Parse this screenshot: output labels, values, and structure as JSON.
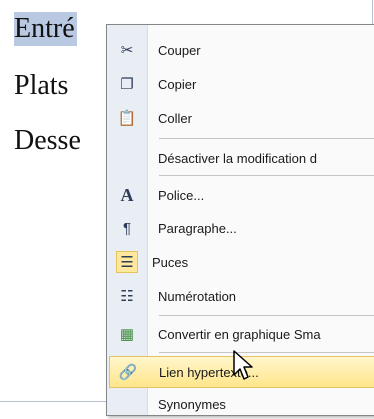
{
  "document": {
    "lines": [
      "Entré",
      "Plats",
      "Desse"
    ]
  },
  "context_menu": {
    "items": [
      {
        "label": "Couper",
        "icon": "scissors-icon",
        "glyph": "✂"
      },
      {
        "label": "Copier",
        "icon": "copy-icon",
        "glyph": "❐"
      },
      {
        "label": "Coller",
        "icon": "paste-icon",
        "glyph": "📋"
      },
      {
        "label": "Désactiver la modification d",
        "icon": "",
        "glyph": ""
      },
      {
        "label": "Police...",
        "icon": "font-icon",
        "glyph": "A"
      },
      {
        "label": "Paragraphe...",
        "icon": "paragraph-icon",
        "glyph": "¶"
      },
      {
        "label": "Puces",
        "icon": "bullets-icon",
        "glyph": "☰"
      },
      {
        "label": "Numérotation",
        "icon": "numbering-icon",
        "glyph": "☷"
      },
      {
        "label": "Convertir en graphique Sma",
        "icon": "smartart-icon",
        "glyph": "▦"
      },
      {
        "label": "Lien hypertexte...",
        "icon": "hyperlink-icon",
        "glyph": "🔗"
      },
      {
        "label": "Synonymes",
        "icon": "",
        "glyph": ""
      }
    ]
  },
  "colors": {
    "selection": "#b9c9e2",
    "hover": "#ffe58a",
    "gutter": "#e9eef5"
  }
}
